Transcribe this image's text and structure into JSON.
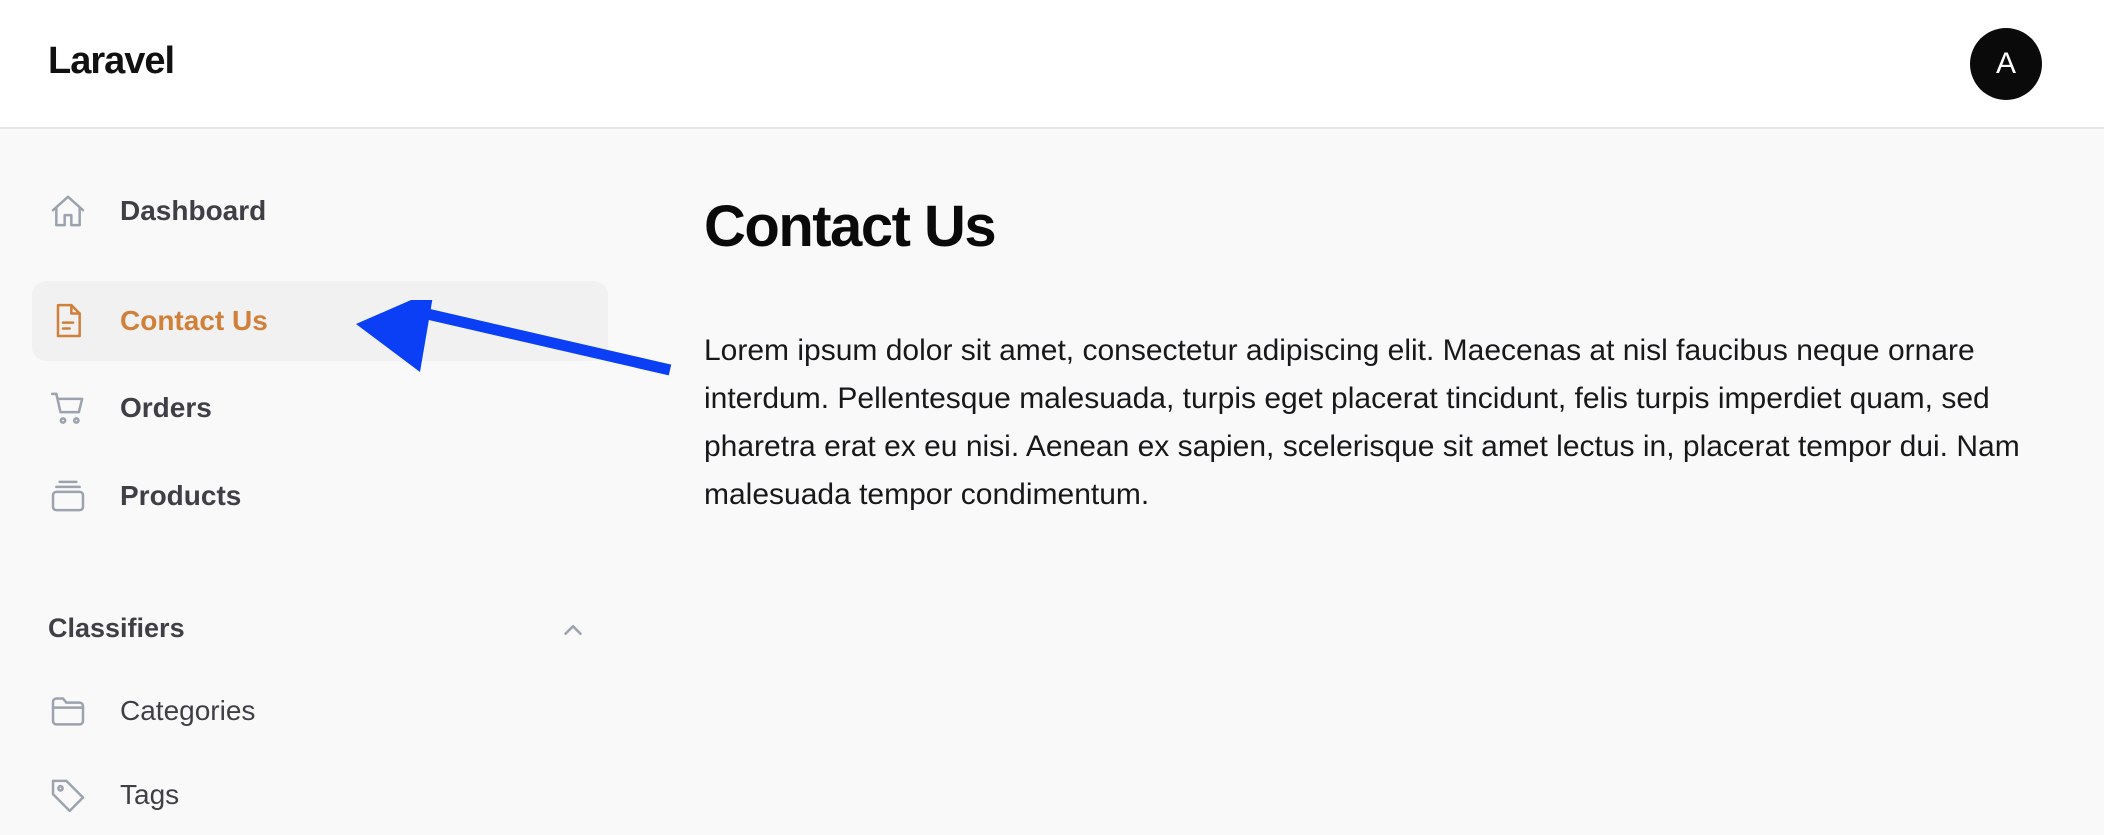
{
  "header": {
    "brand": "Laravel",
    "avatar_initial": "A"
  },
  "sidebar": {
    "items": [
      {
        "label": "Dashboard",
        "icon": "home-icon",
        "active": false
      },
      {
        "label": "Contact Us",
        "icon": "document-icon",
        "active": true
      },
      {
        "label": "Orders",
        "icon": "cart-icon",
        "active": false
      },
      {
        "label": "Products",
        "icon": "stack-icon",
        "active": false
      }
    ],
    "groups": [
      {
        "title": "Classifiers",
        "expanded": true,
        "items": [
          {
            "label": "Categories",
            "icon": "folder-icon"
          },
          {
            "label": "Tags",
            "icon": "tag-icon"
          }
        ]
      }
    ]
  },
  "main": {
    "title": "Contact Us",
    "body": "Lorem ipsum dolor sit amet, consectetur adipiscing elit. Maecenas at nisl faucibus neque ornare interdum. Pellentesque malesuada, turpis eget placerat tincidunt, felis turpis imperdiet quam, sed pharetra erat ex eu nisi. Aenean ex sapien, scelerisque sit amet lectus in, placerat tempor dui. Nam malesuada tempor condimentum."
  },
  "colors": {
    "accent": "#d1803a",
    "annotation_arrow": "#0a3ff5",
    "avatar_bg": "#0a0a0a",
    "page_bg": "#f9f9f9"
  }
}
